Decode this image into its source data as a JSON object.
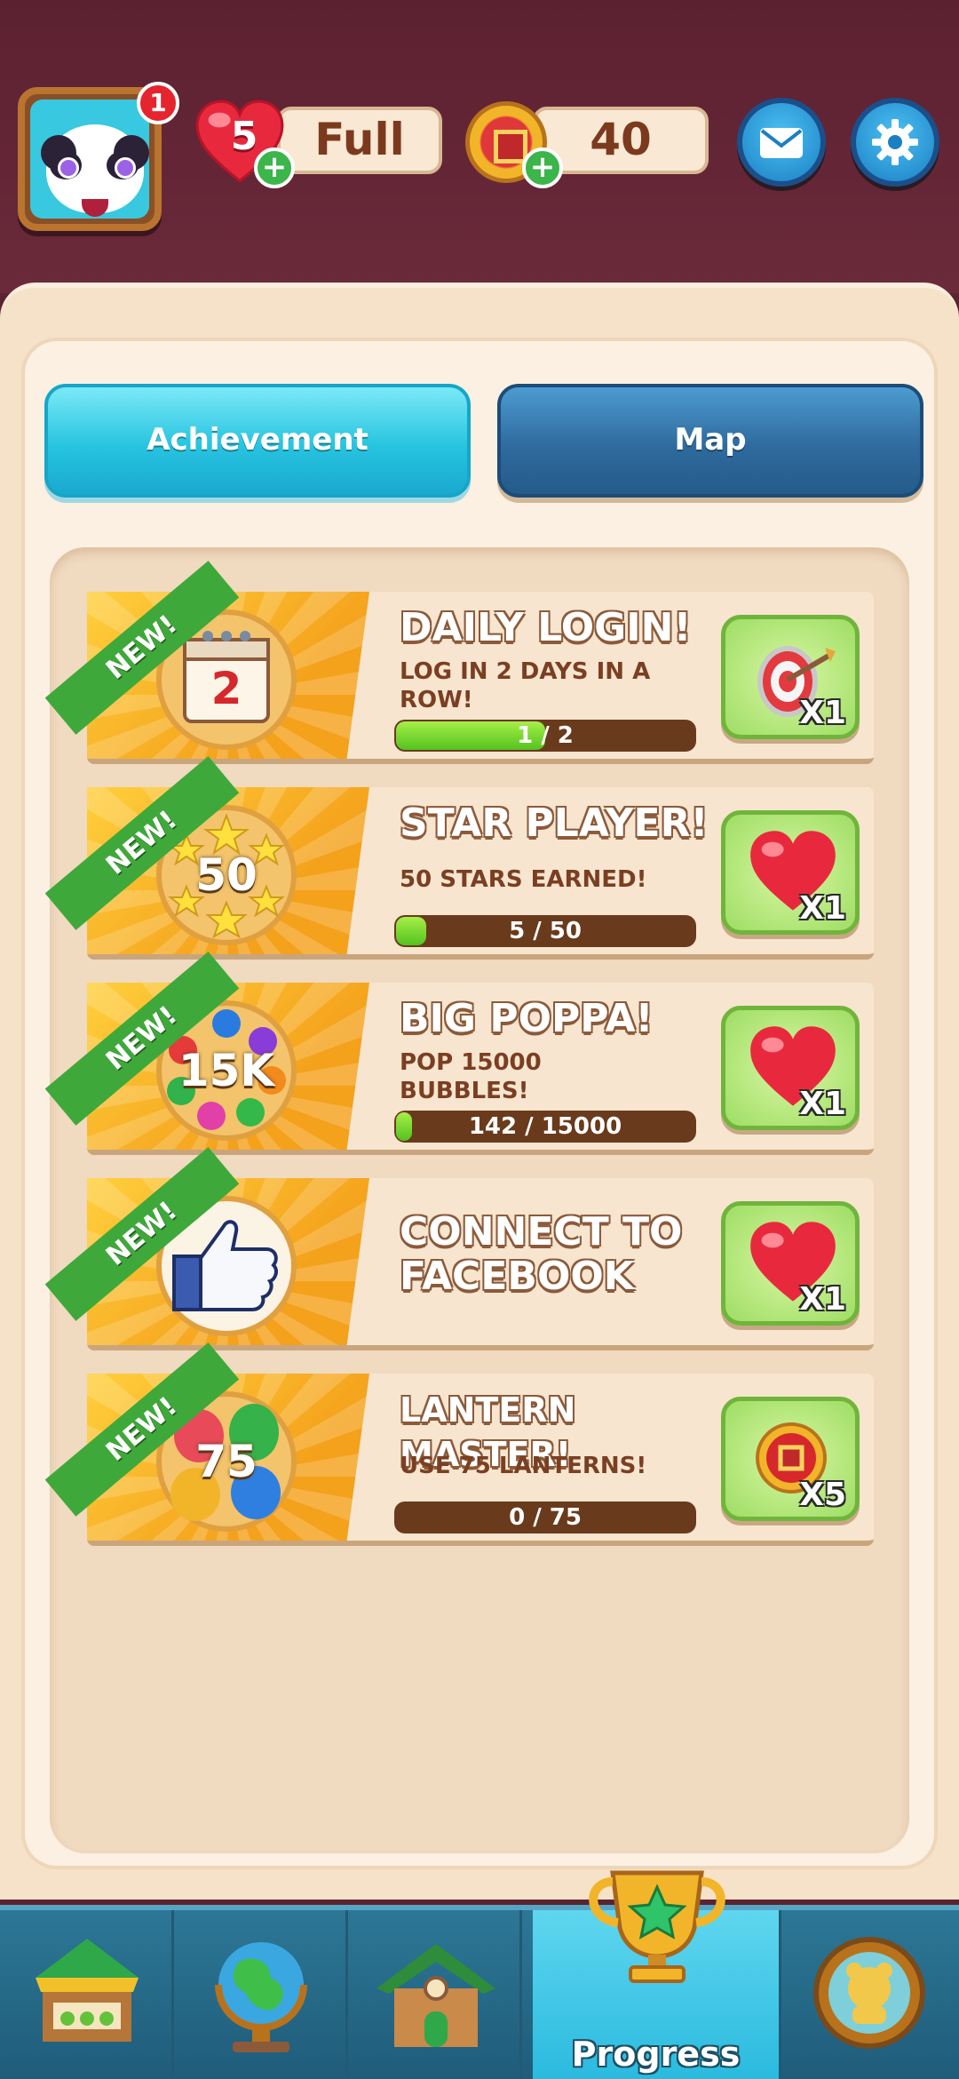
{
  "header": {
    "notification_count": "1",
    "lives_count": "5",
    "lives_status": "Full",
    "coins": "40",
    "plus_label": "+"
  },
  "tabs": [
    {
      "label": "Achievement",
      "active": true
    },
    {
      "label": "Map",
      "active": false
    }
  ],
  "achievements": [
    {
      "ribbon": "NEW!",
      "medal_text": "2",
      "title": "DAILY LOGIN!",
      "description": "LOG IN 2 DAYS IN A ROW!",
      "progress_text": "1 / 2",
      "progress": 0.5,
      "reward_icon": "target-icon",
      "reward_qty": "X1"
    },
    {
      "ribbon": "NEW!",
      "medal_text": "50",
      "title": "STAR PLAYER!",
      "description": "50 STARS EARNED!",
      "progress_text": "5 / 50",
      "progress": 0.1,
      "reward_icon": "heart-icon",
      "reward_qty": "X1"
    },
    {
      "ribbon": "NEW!",
      "medal_text": "15K",
      "title": "BIG POPPA!",
      "description": "POP 15000 BUBBLES!",
      "progress_text": "142 / 15000",
      "progress": 0.0095,
      "reward_icon": "heart-icon",
      "reward_qty": "X1"
    },
    {
      "ribbon": "NEW!",
      "medal_text": "",
      "title": "CONNECT TO FACEBOOK",
      "description": "",
      "progress_text": "",
      "progress": null,
      "reward_icon": "heart-icon",
      "reward_qty": "X1"
    },
    {
      "ribbon": "NEW!",
      "medal_text": "75",
      "title": "LANTERN MASTER!",
      "description": "USE 75 LANTERNS!",
      "progress_text": "0 / 75",
      "progress": 0,
      "reward_icon": "coin-icon",
      "reward_qty": "X5"
    }
  ],
  "bottom_nav": [
    {
      "icon": "shop-icon",
      "label": ""
    },
    {
      "icon": "globe-icon",
      "label": ""
    },
    {
      "icon": "house-icon",
      "label": ""
    },
    {
      "icon": "trophy-icon",
      "label": "Progress",
      "active": true
    },
    {
      "icon": "collection-icon",
      "label": ""
    }
  ],
  "colors": {
    "header_bg": "#5c2131",
    "panel_bg": "#f5e2c8",
    "tab_active": "#27c4e0",
    "tab_inactive": "#2f6b9e",
    "progress_fill": "#54c21f",
    "progress_track": "#6a3a1c",
    "ribbon": "#3fa83a",
    "reward_bg": "#9edd64",
    "nav_bg": "#2d7796",
    "nav_active": "#29b9de"
  }
}
